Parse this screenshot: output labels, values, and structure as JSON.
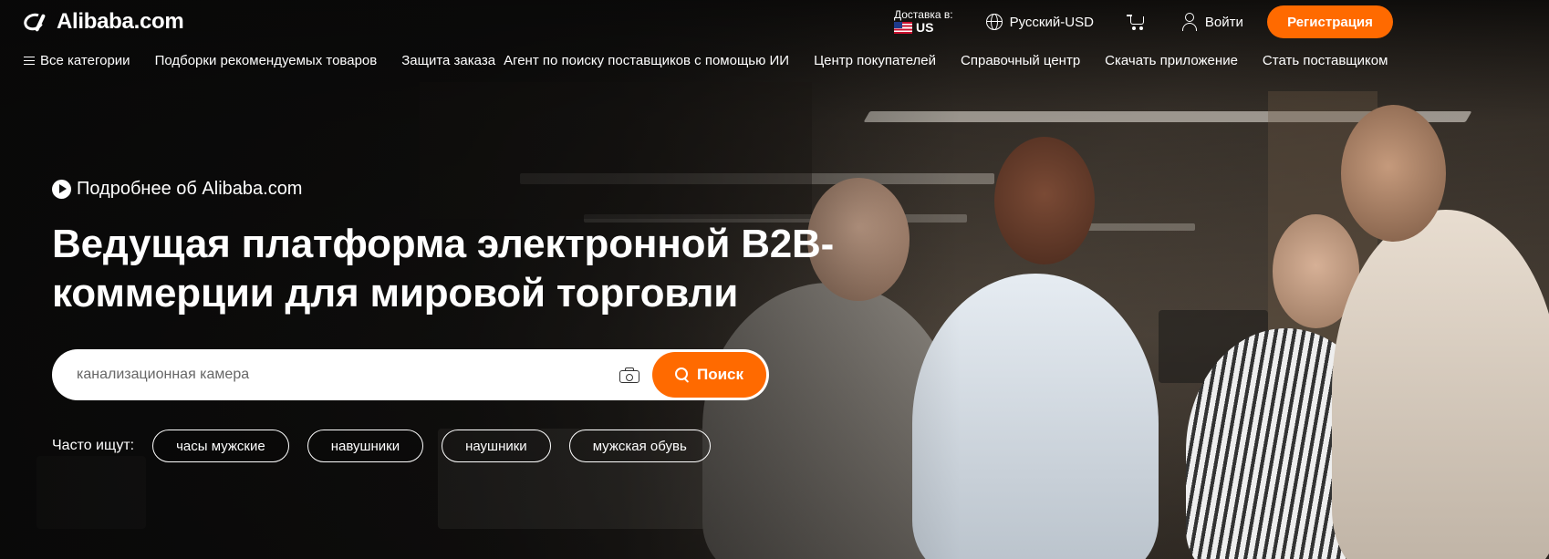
{
  "header": {
    "logo_text": "Alibaba.com",
    "ship_to_label": "Доставка в:",
    "ship_to_country": "US",
    "language_currency": "Русский-USD",
    "login_label": "Войти",
    "register_label": "Регистрация"
  },
  "nav": {
    "items": [
      "Все категории",
      "Подборки рекомендуемых товаров",
      "Защита заказа",
      "Агент по поиску поставщиков с помощью ИИ",
      "Центр покупателей",
      "Справочный центр",
      "Скачать приложение",
      "Стать поставщиком"
    ]
  },
  "hero": {
    "learn_more": "Подробнее об Alibaba.com",
    "headline_line1": "Ведущая платформа электронной B2B-",
    "headline_line2": "коммерции для мировой торговли"
  },
  "search": {
    "placeholder": "канализационная камера",
    "button_label": "Поиск"
  },
  "popular": {
    "label": "Часто ищут:",
    "chips": [
      "часы мужские",
      "навушники",
      "наушники",
      "мужская обувь"
    ]
  },
  "colors": {
    "accent": "#ff6a00",
    "text": "#ffffff"
  },
  "icons": [
    "menu-icon",
    "globe-icon",
    "cart-icon",
    "user-icon",
    "play-icon",
    "camera-icon",
    "search-icon",
    "us-flag-icon"
  ]
}
